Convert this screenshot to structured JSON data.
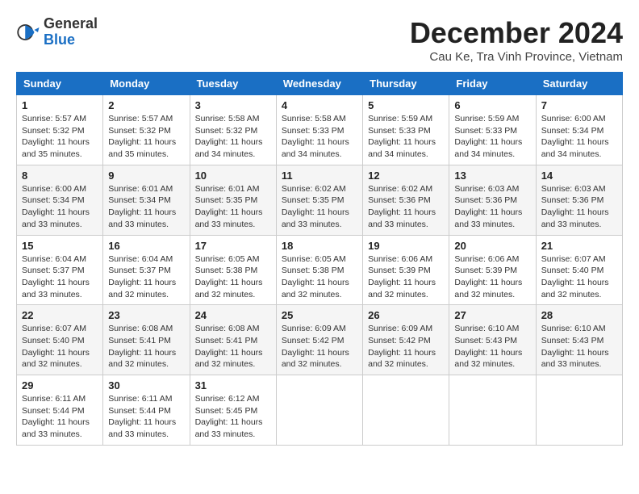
{
  "logo": {
    "general": "General",
    "blue": "Blue"
  },
  "title": "December 2024",
  "subtitle": "Cau Ke, Tra Vinh Province, Vietnam",
  "headers": [
    "Sunday",
    "Monday",
    "Tuesday",
    "Wednesday",
    "Thursday",
    "Friday",
    "Saturday"
  ],
  "weeks": [
    [
      {
        "day": "1",
        "sunrise": "5:57 AM",
        "sunset": "5:32 PM",
        "daylight": "11 hours and 35 minutes."
      },
      {
        "day": "2",
        "sunrise": "5:57 AM",
        "sunset": "5:32 PM",
        "daylight": "11 hours and 35 minutes."
      },
      {
        "day": "3",
        "sunrise": "5:58 AM",
        "sunset": "5:32 PM",
        "daylight": "11 hours and 34 minutes."
      },
      {
        "day": "4",
        "sunrise": "5:58 AM",
        "sunset": "5:33 PM",
        "daylight": "11 hours and 34 minutes."
      },
      {
        "day": "5",
        "sunrise": "5:59 AM",
        "sunset": "5:33 PM",
        "daylight": "11 hours and 34 minutes."
      },
      {
        "day": "6",
        "sunrise": "5:59 AM",
        "sunset": "5:33 PM",
        "daylight": "11 hours and 34 minutes."
      },
      {
        "day": "7",
        "sunrise": "6:00 AM",
        "sunset": "5:34 PM",
        "daylight": "11 hours and 34 minutes."
      }
    ],
    [
      {
        "day": "8",
        "sunrise": "6:00 AM",
        "sunset": "5:34 PM",
        "daylight": "11 hours and 33 minutes."
      },
      {
        "day": "9",
        "sunrise": "6:01 AM",
        "sunset": "5:34 PM",
        "daylight": "11 hours and 33 minutes."
      },
      {
        "day": "10",
        "sunrise": "6:01 AM",
        "sunset": "5:35 PM",
        "daylight": "11 hours and 33 minutes."
      },
      {
        "day": "11",
        "sunrise": "6:02 AM",
        "sunset": "5:35 PM",
        "daylight": "11 hours and 33 minutes."
      },
      {
        "day": "12",
        "sunrise": "6:02 AM",
        "sunset": "5:36 PM",
        "daylight": "11 hours and 33 minutes."
      },
      {
        "day": "13",
        "sunrise": "6:03 AM",
        "sunset": "5:36 PM",
        "daylight": "11 hours and 33 minutes."
      },
      {
        "day": "14",
        "sunrise": "6:03 AM",
        "sunset": "5:36 PM",
        "daylight": "11 hours and 33 minutes."
      }
    ],
    [
      {
        "day": "15",
        "sunrise": "6:04 AM",
        "sunset": "5:37 PM",
        "daylight": "11 hours and 33 minutes."
      },
      {
        "day": "16",
        "sunrise": "6:04 AM",
        "sunset": "5:37 PM",
        "daylight": "11 hours and 32 minutes."
      },
      {
        "day": "17",
        "sunrise": "6:05 AM",
        "sunset": "5:38 PM",
        "daylight": "11 hours and 32 minutes."
      },
      {
        "day": "18",
        "sunrise": "6:05 AM",
        "sunset": "5:38 PM",
        "daylight": "11 hours and 32 minutes."
      },
      {
        "day": "19",
        "sunrise": "6:06 AM",
        "sunset": "5:39 PM",
        "daylight": "11 hours and 32 minutes."
      },
      {
        "day": "20",
        "sunrise": "6:06 AM",
        "sunset": "5:39 PM",
        "daylight": "11 hours and 32 minutes."
      },
      {
        "day": "21",
        "sunrise": "6:07 AM",
        "sunset": "5:40 PM",
        "daylight": "11 hours and 32 minutes."
      }
    ],
    [
      {
        "day": "22",
        "sunrise": "6:07 AM",
        "sunset": "5:40 PM",
        "daylight": "11 hours and 32 minutes."
      },
      {
        "day": "23",
        "sunrise": "6:08 AM",
        "sunset": "5:41 PM",
        "daylight": "11 hours and 32 minutes."
      },
      {
        "day": "24",
        "sunrise": "6:08 AM",
        "sunset": "5:41 PM",
        "daylight": "11 hours and 32 minutes."
      },
      {
        "day": "25",
        "sunrise": "6:09 AM",
        "sunset": "5:42 PM",
        "daylight": "11 hours and 32 minutes."
      },
      {
        "day": "26",
        "sunrise": "6:09 AM",
        "sunset": "5:42 PM",
        "daylight": "11 hours and 32 minutes."
      },
      {
        "day": "27",
        "sunrise": "6:10 AM",
        "sunset": "5:43 PM",
        "daylight": "11 hours and 32 minutes."
      },
      {
        "day": "28",
        "sunrise": "6:10 AM",
        "sunset": "5:43 PM",
        "daylight": "11 hours and 33 minutes."
      }
    ],
    [
      {
        "day": "29",
        "sunrise": "6:11 AM",
        "sunset": "5:44 PM",
        "daylight": "11 hours and 33 minutes."
      },
      {
        "day": "30",
        "sunrise": "6:11 AM",
        "sunset": "5:44 PM",
        "daylight": "11 hours and 33 minutes."
      },
      {
        "day": "31",
        "sunrise": "6:12 AM",
        "sunset": "5:45 PM",
        "daylight": "11 hours and 33 minutes."
      },
      null,
      null,
      null,
      null
    ]
  ]
}
